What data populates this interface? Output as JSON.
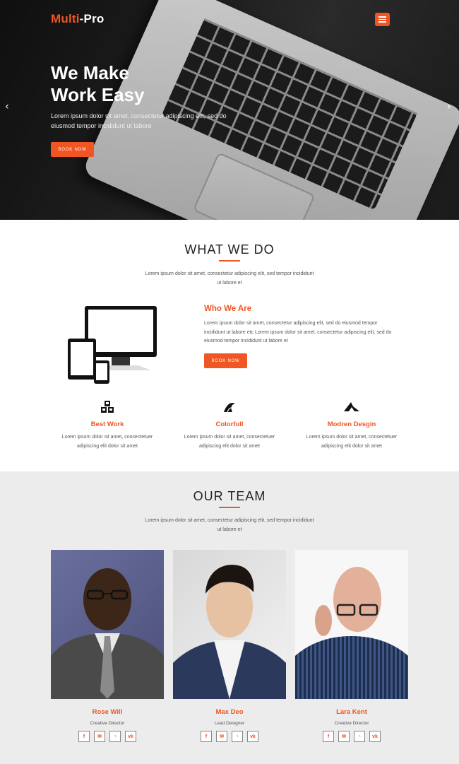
{
  "header": {
    "logo_main": "Multi",
    "logo_dash": "-",
    "logo_pro": "Pro",
    "menu_icon": "hamburger-icon"
  },
  "hero": {
    "title_line1": "We Make",
    "title_line2": "Work Easy",
    "text": "Lorem ipsum dolor sit amet, consectetur adipiscing elit, sed do eiusmod tempor incididunt ut labore",
    "button": "BOOK NOW",
    "prev_icon": "chevron-left-icon",
    "next_icon": "chevron-right-icon",
    "prev_glyph": "‹",
    "next_glyph": "›"
  },
  "what_we_do": {
    "title": "WHAT WE DO",
    "intro": "Lorem ipsum dolor sit amet, consectetur adipiscing elit, sed tempor incididunt ut labore et",
    "who_title": "Who We Are",
    "who_text": "Lorem ipsum dolor sit amet, consectetur adipiscing elit, sed do eiusmod tempor incididunt ut labore etc Lorem ipsum dolor sit amet, consectetur adipiscing elit, sed do eiusmod tempor incididunt ut labore et",
    "who_button": "BOOK NOW",
    "features": [
      {
        "icon": "cubes-icon",
        "title": "Best Work",
        "text": "Lorem ipsum dolor sit amet, consectetuer adipiscing elit dolor sit amet"
      },
      {
        "icon": "wave-icon",
        "title": "Colorfull",
        "text": "Lorem ipsum dolor sit amet, consectetuer adipiscing elit dolor sit amet"
      },
      {
        "icon": "shark-icon",
        "title": "Modren Desgin",
        "text": "Lorem ipsum dolor sit amet, consectetuer adipiscing elit dolor sit amet"
      }
    ]
  },
  "team": {
    "title": "OUR TEAM",
    "intro": "Lorem ipsum dolor sit amet, consectetur adipiscing elit, sed tempor incididunt ut labore et",
    "members": [
      {
        "name": "Rose Will",
        "role": "Creative Director"
      },
      {
        "name": "Max Deo",
        "role": "Lead Designer"
      },
      {
        "name": "Lara Kent",
        "role": "Creative Director"
      }
    ],
    "social_labels": {
      "facebook": "f",
      "email": "✉",
      "rss": "◔",
      "vk": "vk"
    }
  },
  "colors": {
    "accent": "#f05523",
    "hero_bg": "#1a1a1a",
    "team_bg": "#ececec"
  }
}
